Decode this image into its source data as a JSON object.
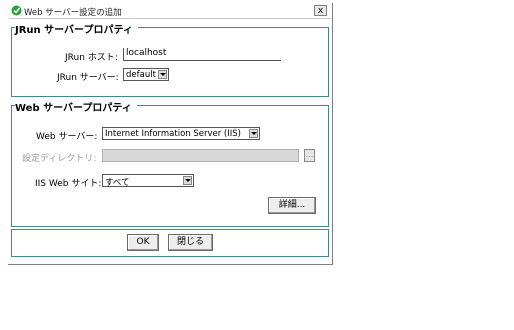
{
  "window": {
    "title": "Web サーバー設定の追加",
    "close_label": "x"
  },
  "jrun_group": {
    "legend": "JRun サーバープロパティ",
    "host_label": "JRun ホスト:",
    "host_value": "localhost",
    "server_label": "JRun サーバー:",
    "server_value": "default"
  },
  "web_group": {
    "legend": "Web サーバープロパティ",
    "webserver_label": "Web サーバー:",
    "webserver_value": "Internet Information Server (IIS)",
    "config_dir_label": "設定ディレクトリ:",
    "config_dir_browse": "...",
    "iis_site_label": "IIS Web サイト:",
    "iis_site_value": "すべて",
    "details_button": "詳細..."
  },
  "buttons": {
    "ok": "OK",
    "close": "閉じる"
  },
  "colors": {
    "group_border": "#3e8a8a",
    "app_icon": "#2f9e3a"
  },
  "icons": {
    "app": "green-check-circle-icon",
    "close": "close-icon",
    "dropdown": "chevron-down-icon"
  }
}
